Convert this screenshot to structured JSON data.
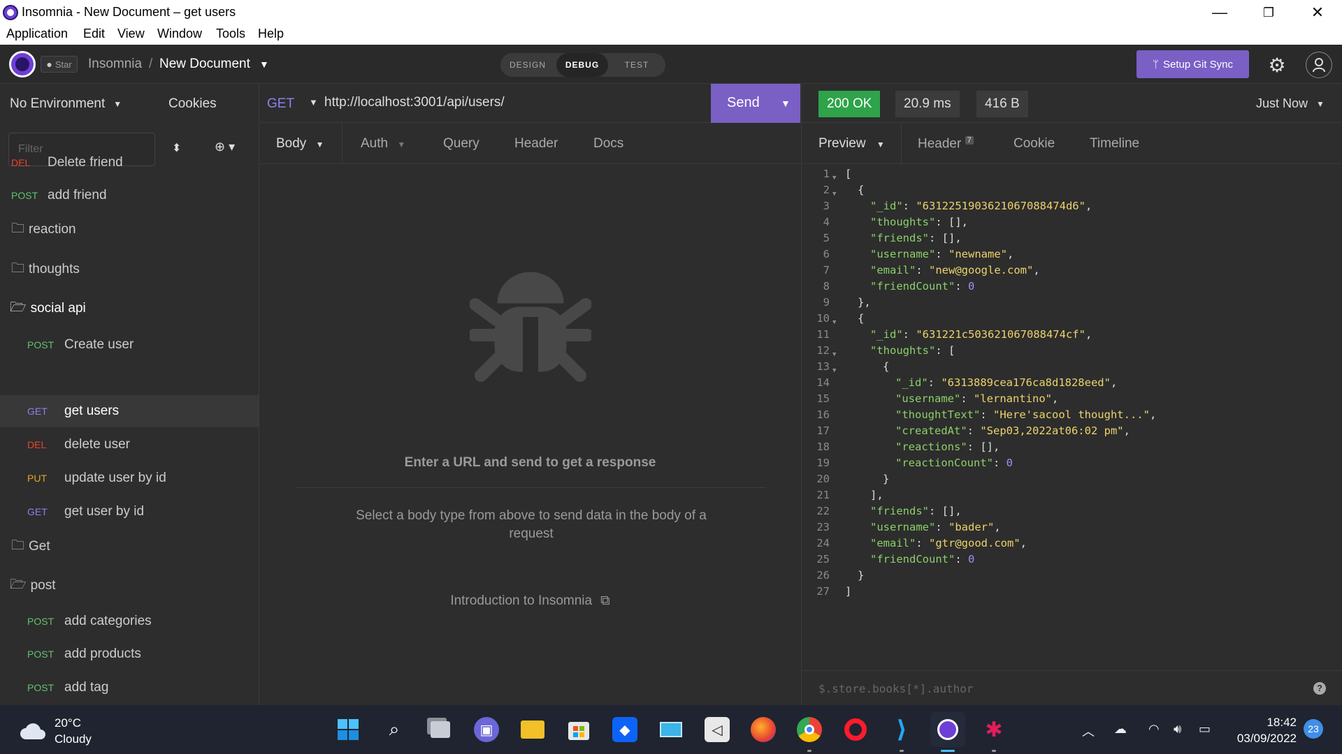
{
  "window": {
    "title": "Insomnia - New Document – get users",
    "minimize": "—",
    "maximize": "❐",
    "close": "✕"
  },
  "menu": [
    "Application",
    "Edit",
    "View",
    "Window",
    "Tools",
    "Help"
  ],
  "header": {
    "star_label": "Star",
    "breadcrumb_root": "Insomnia",
    "breadcrumb_sep": "/",
    "breadcrumb_doc": "New Document",
    "modes": [
      "DESIGN",
      "DEBUG",
      "TEST"
    ],
    "active_mode": "DEBUG",
    "git_sync_label": "Setup Git Sync"
  },
  "sidebar": {
    "environment": "No Environment",
    "cookies": "Cookies",
    "filter_placeholder": "Filter",
    "items": [
      {
        "type": "request",
        "method": "DEL",
        "label": "Delete friend",
        "indent": 0
      },
      {
        "type": "request",
        "method": "POST",
        "label": "add friend",
        "indent": 0
      },
      {
        "type": "folder",
        "label": "reaction",
        "open": false
      },
      {
        "type": "folder",
        "label": "thoughts",
        "open": false
      },
      {
        "type": "folder",
        "label": "social api",
        "open": true
      },
      {
        "type": "request",
        "method": "POST",
        "label": "Create user",
        "indent": 1
      },
      {
        "type": "request",
        "method": "GET",
        "label": "get users",
        "indent": 1,
        "active": true
      },
      {
        "type": "request",
        "method": "DEL",
        "label": "delete user",
        "indent": 1
      },
      {
        "type": "request",
        "method": "PUT",
        "label": "update user by id",
        "indent": 1
      },
      {
        "type": "request",
        "method": "GET",
        "label": "get user by id",
        "indent": 1
      },
      {
        "type": "folder",
        "label": "Get",
        "open": false
      },
      {
        "type": "folder",
        "label": "post",
        "open": true
      },
      {
        "type": "request",
        "method": "POST",
        "label": "add categories",
        "indent": 1
      },
      {
        "type": "request",
        "method": "POST",
        "label": "add products",
        "indent": 1
      },
      {
        "type": "request",
        "method": "POST",
        "label": "add tag",
        "indent": 1
      }
    ]
  },
  "request": {
    "method": "GET",
    "url": "http://localhost:3001/api/users/",
    "send_label": "Send",
    "tabs": [
      "Body",
      "Auth",
      "Query",
      "Header",
      "Docs"
    ],
    "empty_title": "Enter a URL and send to get a response",
    "empty_hint": "Select a body type from above to send data in the body of a request",
    "intro_link": "Introduction to Insomnia"
  },
  "response": {
    "status": "200 OK",
    "time": "20.9 ms",
    "size": "416 B",
    "when": "Just Now",
    "tabs": [
      "Preview",
      "Header",
      "Cookie",
      "Timeline"
    ],
    "header_count": "7",
    "filter_placeholder": "$.store.books[*].author",
    "help": "?"
  },
  "taskbar": {
    "temperature": "20°C",
    "condition": "Cloudy",
    "time": "18:42",
    "date": "03/09/2022",
    "notifications": "23"
  },
  "colors": {
    "accent": "#7a5fc5",
    "ok": "#2ea34a",
    "get": "#8c7ff0",
    "post": "#61c26e",
    "del": "#e7442f",
    "put": "#e6a22a"
  }
}
